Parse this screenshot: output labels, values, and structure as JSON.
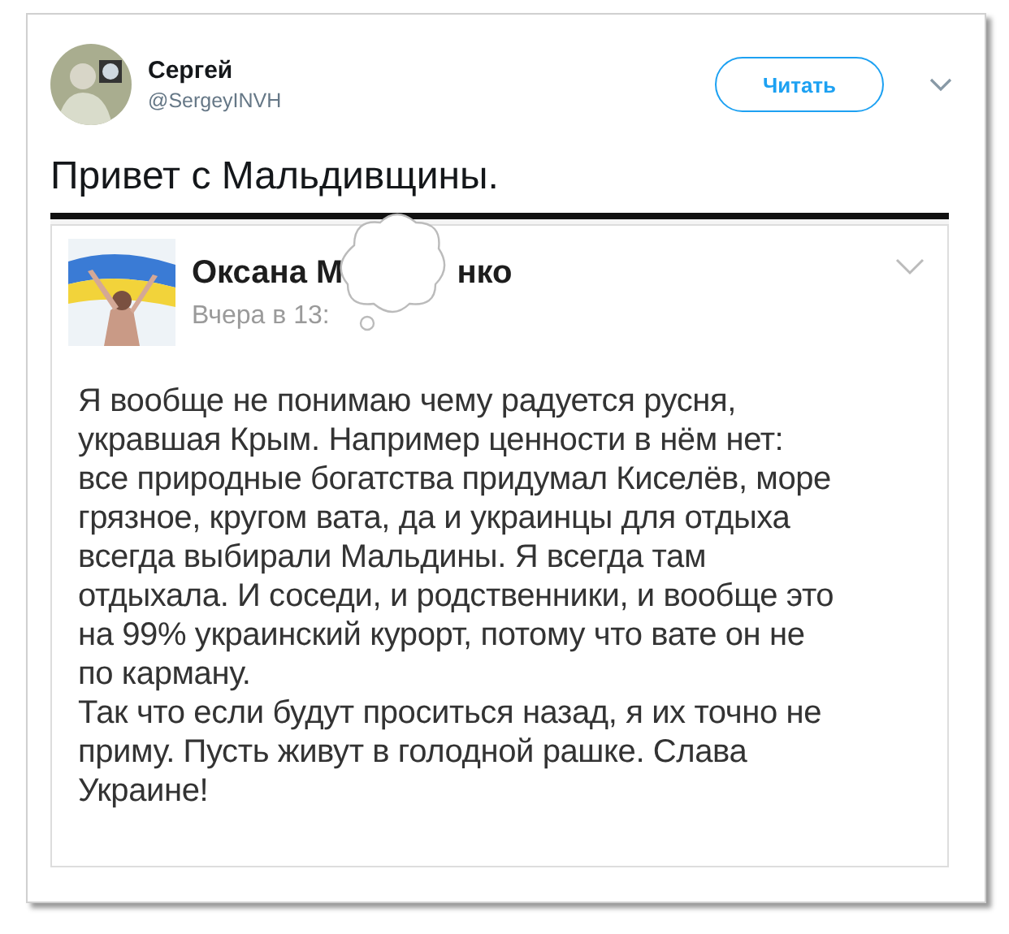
{
  "tweet": {
    "author": {
      "name": "Сергей",
      "handle": "@SergeyINVH"
    },
    "follow_button": "Читать",
    "text": "Привет с Мальдивщины.",
    "embedded_post": {
      "author_name_parts": [
        "Оксана М",
        "нко"
      ],
      "time": "Вчера в 13:",
      "paragraphs": [
        [
          "Я вообще не понимаю чему радуется русня,",
          "укравшая Крым. Например ценности в нём нет:",
          "все природные богатства придумал Киселёв, море",
          "грязное, кругом вата, да и украинцы для отдыха",
          "всегда выбирали Мальдины. Я всегда там",
          "отдыхала. И соседи, и родственники, и вообще это",
          "на 99% украинский курорт, потому что вате он не",
          "по карману."
        ],
        [
          "Так что если будут проситься назад, я их точно не",
          "приму. Пусть живут в голодной рашке. Слава",
          "Украине!"
        ]
      ]
    }
  }
}
